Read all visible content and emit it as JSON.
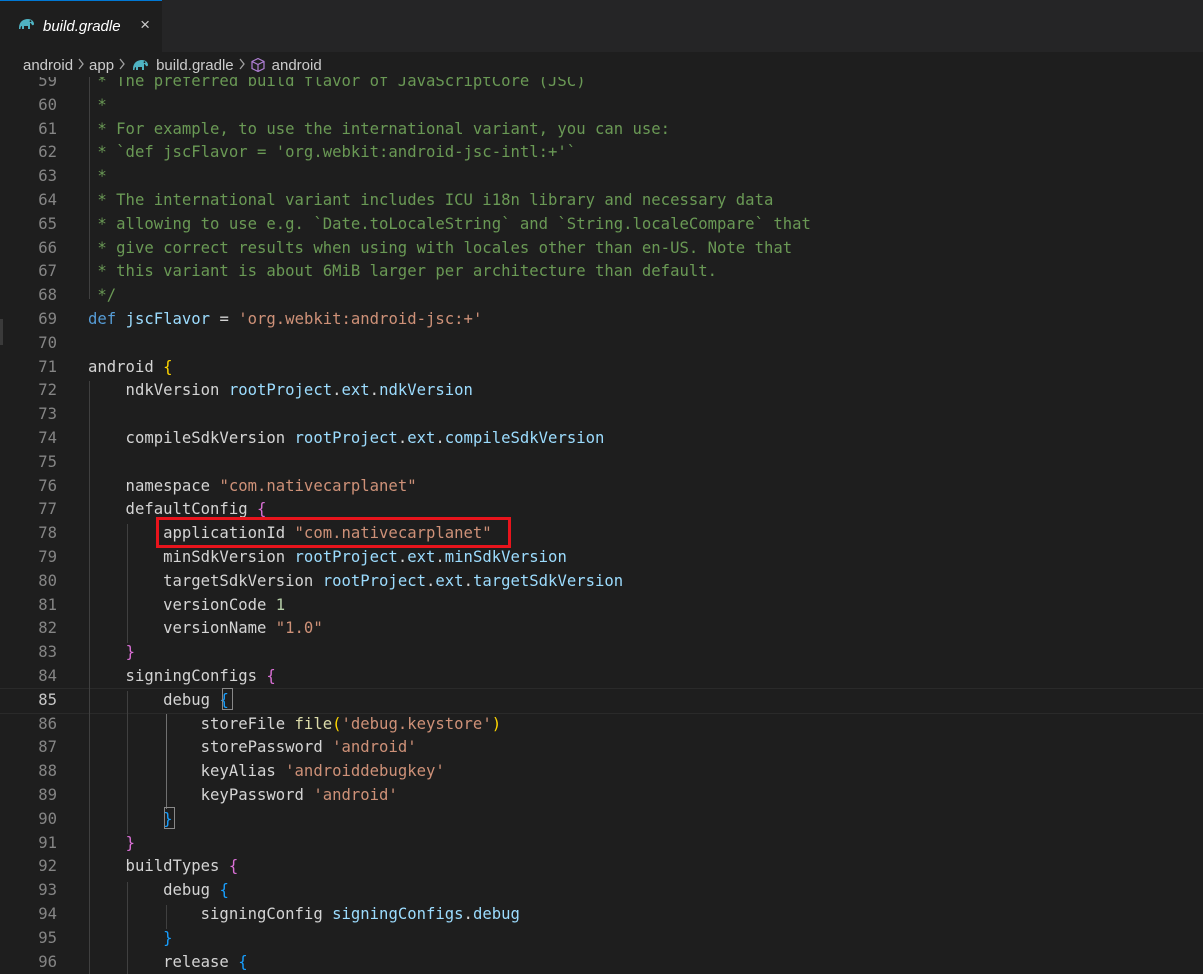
{
  "tab": {
    "label": "build.gradle",
    "close": "×",
    "icon": "gradle-elephant-icon"
  },
  "breadcrumb": {
    "items": [
      "android",
      "app",
      "build.gradle",
      "android"
    ],
    "icons": [
      "gradle-elephant-icon",
      "module-cube-icon"
    ]
  },
  "editor": {
    "active_line": 85,
    "highlighted_line": 78,
    "lines": [
      {
        "n": "59",
        "tokens": [
          [
            "cm",
            " * The preferred build flavor of JavaScriptCore (JSC)"
          ]
        ]
      },
      {
        "n": "60",
        "tokens": [
          [
            "cm",
            " *"
          ]
        ]
      },
      {
        "n": "61",
        "tokens": [
          [
            "cm",
            " * For example, to use the international variant, you can use:"
          ]
        ]
      },
      {
        "n": "62",
        "tokens": [
          [
            "cm",
            " * `def jscFlavor = 'org.webkit:android-jsc-intl:+'`"
          ]
        ]
      },
      {
        "n": "63",
        "tokens": [
          [
            "cm",
            " *"
          ]
        ]
      },
      {
        "n": "64",
        "tokens": [
          [
            "cm",
            " * The international variant includes ICU i18n library and necessary data"
          ]
        ]
      },
      {
        "n": "65",
        "tokens": [
          [
            "cm",
            " * allowing to use e.g. `Date.toLocaleString` and `String.localeCompare` that"
          ]
        ]
      },
      {
        "n": "66",
        "tokens": [
          [
            "cm",
            " * give correct results when using with locales other than en-US. Note that"
          ]
        ]
      },
      {
        "n": "67",
        "tokens": [
          [
            "cm",
            " * this variant is about 6MiB larger per architecture than default."
          ]
        ]
      },
      {
        "n": "68",
        "tokens": [
          [
            "cm",
            " */"
          ]
        ]
      },
      {
        "n": "69",
        "tokens": [
          [
            "kw",
            "def"
          ],
          [
            "pl",
            " "
          ],
          [
            "id",
            "jscFlavor"
          ],
          [
            "pl",
            " = "
          ],
          [
            "st",
            "'org.webkit:android-jsc:+'"
          ]
        ]
      },
      {
        "n": "70",
        "tokens": []
      },
      {
        "n": "71",
        "tokens": [
          [
            "pl",
            "android "
          ],
          [
            "b1",
            "{"
          ]
        ]
      },
      {
        "n": "72",
        "tokens": [
          [
            "pl",
            "    ndkVersion "
          ],
          [
            "id",
            "rootProject"
          ],
          [
            "pl",
            "."
          ],
          [
            "id",
            "ext"
          ],
          [
            "pl",
            "."
          ],
          [
            "id",
            "ndkVersion"
          ]
        ]
      },
      {
        "n": "73",
        "tokens": []
      },
      {
        "n": "74",
        "tokens": [
          [
            "pl",
            "    compileSdkVersion "
          ],
          [
            "id",
            "rootProject"
          ],
          [
            "pl",
            "."
          ],
          [
            "id",
            "ext"
          ],
          [
            "pl",
            "."
          ],
          [
            "id",
            "compileSdkVersion"
          ]
        ]
      },
      {
        "n": "75",
        "tokens": []
      },
      {
        "n": "76",
        "tokens": [
          [
            "pl",
            "    namespace "
          ],
          [
            "st",
            "\"com.nativecarplanet\""
          ]
        ]
      },
      {
        "n": "77",
        "tokens": [
          [
            "pl",
            "    defaultConfig "
          ],
          [
            "b2",
            "{"
          ]
        ]
      },
      {
        "n": "78",
        "tokens": [
          [
            "pl",
            "        applicationId "
          ],
          [
            "st",
            "\"com.nativecarplanet\""
          ]
        ]
      },
      {
        "n": "79",
        "tokens": [
          [
            "pl",
            "        minSdkVersion "
          ],
          [
            "id",
            "rootProject"
          ],
          [
            "pl",
            "."
          ],
          [
            "id",
            "ext"
          ],
          [
            "pl",
            "."
          ],
          [
            "id",
            "minSdkVersion"
          ]
        ]
      },
      {
        "n": "80",
        "tokens": [
          [
            "pl",
            "        targetSdkVersion "
          ],
          [
            "id",
            "rootProject"
          ],
          [
            "pl",
            "."
          ],
          [
            "id",
            "ext"
          ],
          [
            "pl",
            "."
          ],
          [
            "id",
            "targetSdkVersion"
          ]
        ]
      },
      {
        "n": "81",
        "tokens": [
          [
            "pl",
            "        versionCode "
          ],
          [
            "nm",
            "1"
          ]
        ]
      },
      {
        "n": "82",
        "tokens": [
          [
            "pl",
            "        versionName "
          ],
          [
            "st",
            "\"1.0\""
          ]
        ]
      },
      {
        "n": "83",
        "tokens": [
          [
            "pl",
            "    "
          ],
          [
            "b2",
            "}"
          ]
        ]
      },
      {
        "n": "84",
        "tokens": [
          [
            "pl",
            "    signingConfigs "
          ],
          [
            "b2",
            "{"
          ]
        ]
      },
      {
        "n": "85",
        "tokens": [
          [
            "pl",
            "        debug "
          ],
          [
            "b3",
            "{"
          ]
        ]
      },
      {
        "n": "86",
        "tokens": [
          [
            "pl",
            "            storeFile "
          ],
          [
            "fn",
            "file"
          ],
          [
            "b1",
            "("
          ],
          [
            "st",
            "'debug.keystore'"
          ],
          [
            "b1",
            ")"
          ]
        ]
      },
      {
        "n": "87",
        "tokens": [
          [
            "pl",
            "            storePassword "
          ],
          [
            "st",
            "'android'"
          ]
        ]
      },
      {
        "n": "88",
        "tokens": [
          [
            "pl",
            "            keyAlias "
          ],
          [
            "st",
            "'androiddebugkey'"
          ]
        ]
      },
      {
        "n": "89",
        "tokens": [
          [
            "pl",
            "            keyPassword "
          ],
          [
            "st",
            "'android'"
          ]
        ]
      },
      {
        "n": "90",
        "tokens": [
          [
            "pl",
            "        "
          ],
          [
            "b3",
            "}"
          ]
        ]
      },
      {
        "n": "91",
        "tokens": [
          [
            "pl",
            "    "
          ],
          [
            "b2",
            "}"
          ]
        ]
      },
      {
        "n": "92",
        "tokens": [
          [
            "pl",
            "    buildTypes "
          ],
          [
            "b2",
            "{"
          ]
        ]
      },
      {
        "n": "93",
        "tokens": [
          [
            "pl",
            "        debug "
          ],
          [
            "b3",
            "{"
          ]
        ]
      },
      {
        "n": "94",
        "tokens": [
          [
            "pl",
            "            signingConfig "
          ],
          [
            "id",
            "signingConfigs"
          ],
          [
            "pl",
            "."
          ],
          [
            "id",
            "debug"
          ]
        ]
      },
      {
        "n": "95",
        "tokens": [
          [
            "pl",
            "        "
          ],
          [
            "b3",
            "}"
          ]
        ]
      },
      {
        "n": "96",
        "tokens": [
          [
            "pl",
            "        release "
          ],
          [
            "b3",
            "{"
          ]
        ]
      }
    ]
  }
}
